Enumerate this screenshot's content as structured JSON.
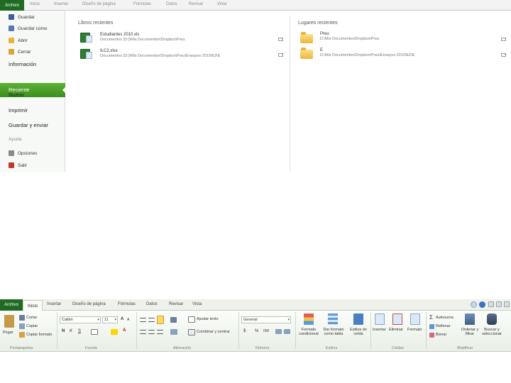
{
  "backstage": {
    "file_tab": "Archivo",
    "tabs": [
      "Inicio",
      "Insertar",
      "Diseño de página",
      "Fórmulas",
      "Datos",
      "Revisar",
      "Vista"
    ],
    "menu": {
      "save": "Guardar",
      "save_as": "Guardar como",
      "open": "Abrir",
      "close": "Cerrar",
      "info": "Información",
      "recent": "Reciente",
      "new": "Nuevo",
      "print": "Imprimir",
      "save_send": "Guardar y enviar",
      "help": "Ayuda",
      "options": "Opciones",
      "exit": "Salir"
    },
    "recent_books_title": "Libros recientes",
    "recent_books": [
      {
        "name": "Estudiantes 2010.xls",
        "path": "Documentos (D:)\\Mis Documentos\\Dropbox\\Preu"
      },
      {
        "name": "ILC2.xlsx",
        "path": "Documentos (D:)\\Mis Documentos\\Dropbox\\Preu\\Ensayos 2010\\E2\\E"
      }
    ],
    "recent_places_title": "Lugares recientes",
    "recent_places": [
      {
        "name": "Preu",
        "path": "D:\\Mis Documentos\\Dropbox\\Preu"
      },
      {
        "name": "E",
        "path": "D:\\Mis Documentos\\Dropbox\\Preu\\Ensayos 2010\\E2\\E"
      }
    ]
  },
  "ribbon": {
    "file_tab": "Archivo",
    "home_tab": "Inicio",
    "tabs": [
      "Insertar",
      "Diseño de página",
      "Fórmulas",
      "Datos",
      "Revisar",
      "Vista"
    ],
    "clipboard": {
      "paste": "Pegar",
      "cut": "Cortar",
      "copy": "Copiar",
      "format_painter": "Copiar formato",
      "label": "Portapapeles"
    },
    "font": {
      "name": "Calibri",
      "size": "11",
      "bold": "N",
      "italic": "K",
      "underline": "S",
      "label": "Fuente"
    },
    "alignment": {
      "wrap": "Ajustar texto",
      "merge": "Combinar y centrar",
      "label": "Alineación"
    },
    "number": {
      "format": "General",
      "currency": "$",
      "percent": "%",
      "thousands": "000",
      "label": "Número"
    },
    "styles": {
      "conditional": "Formato condicional",
      "as_table": "Dar formato como tabla",
      "cell_styles": "Estilos de celda",
      "label": "Estilos"
    },
    "cells": {
      "insert": "Insertar",
      "delete": "Eliminar",
      "format": "Formato",
      "label": "Celdas"
    },
    "editing": {
      "autosum": "Autosuma",
      "fill": "Rellenar",
      "clear": "Borrar",
      "sort": "Ordenar y filtrar",
      "find": "Buscar y seleccionar",
      "label": "Modificar"
    }
  },
  "colors": {
    "accent_green": "#1f6b24",
    "active_green": "#4aa02a",
    "folder": "#e8b53a"
  }
}
